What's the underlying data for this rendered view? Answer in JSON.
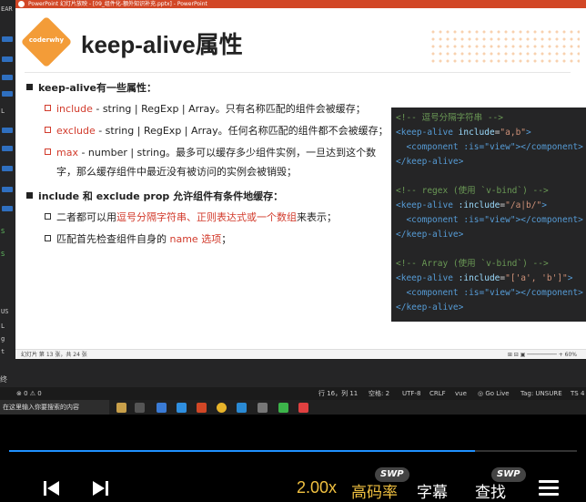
{
  "window": {
    "title": "PowerPoint 幻灯片放映 - [09_组件化-额外知识补充.pptx] - PowerPoint"
  },
  "sidebar": {
    "labels": [
      "EAR",
      "L",
      "S",
      "S",
      "US",
      "L",
      "g",
      "t"
    ]
  },
  "slide": {
    "badge": "coderwhy",
    "title": "keep-alive属性",
    "bullet1": {
      "text": "keep-alive有一些属性："
    },
    "sub1": {
      "key": "include",
      "rest": " - string | RegExp | Array。只有名称匹配的组件会被缓存；"
    },
    "sub2": {
      "key": "exclude",
      "rest": " - string | RegExp | Array。任何名称匹配的组件都不会被缓存；"
    },
    "sub3": {
      "key": "max",
      "rest1": " - number | string。最多可以缓存多少组件实例，一旦达到这个数",
      "rest2": "字，那么缓存组件中最近没有被访问的实例会被销毁；"
    },
    "bullet2": {
      "text": "include 和 exclude prop 允许组件有条件地缓存："
    },
    "sub4": {
      "pre": "二者都可以用",
      "hl": "逗号分隔字符串、正则表达式或一个数组",
      "post": "来表示；"
    },
    "sub5": {
      "pre": "匹配首先检查组件自身的 ",
      "hl": "name 选项",
      "post": "；"
    }
  },
  "code": {
    "lines": [
      {
        "com": "<!-- 逗号分隔字符串 -->"
      },
      {
        "open": "<keep-alive",
        "attr": " include",
        "eq": "=",
        "val": "\"a,b\"",
        "close": ">"
      },
      {
        "indent": true,
        "inner": "<component :is=\"view\"></component>"
      },
      {
        "end": "</keep-alive>"
      },
      {
        "com": "<!-- regex (使用 `v-bind`) -->"
      },
      {
        "open": "<keep-alive",
        "attr": " :include",
        "eq": "=",
        "val": "\"/a|b/\"",
        "close": ">"
      },
      {
        "indent": true,
        "inner": "<component :is=\"view\"></component>"
      },
      {
        "end": "</keep-alive>"
      },
      {
        "com": "<!-- Array (使用 `v-bind`) -->"
      },
      {
        "open": "<keep-alive",
        "attr": " :include",
        "eq": "=",
        "val": "\"['a', 'b']\"",
        "close": ">"
      },
      {
        "indent": true,
        "inner": "<component :is=\"view\"></component>"
      },
      {
        "end": "</keep-alive>"
      }
    ]
  },
  "pp_status": {
    "left": "幻灯片 第 13 张，共 24 张",
    "right": "⊞  ⊟  ▣  ─────────  +  60%"
  },
  "vscode": {
    "panel_label": "终",
    "status": {
      "left": "⊗ 0  ⚠ 0",
      "position": "行 16，列 11",
      "spaces": "空格: 2",
      "encoding": "UTF-8",
      "eol": "CRLF",
      "lang": "vue",
      "golive": "◎ Go Live",
      "tag": "Tag: UNSURE",
      "ts": "TS 4"
    }
  },
  "taskbar": {
    "search": "在这里输入你要搜索的内容"
  },
  "player": {
    "progress": 0.82,
    "speed": "2.00x",
    "bitrate": "高码率",
    "subtitle": "字幕",
    "find": "查找",
    "swp1": "SWP",
    "swp2": "SWP",
    "colors": {
      "accent": "#f0c040",
      "progress": "#1e90ff"
    }
  }
}
